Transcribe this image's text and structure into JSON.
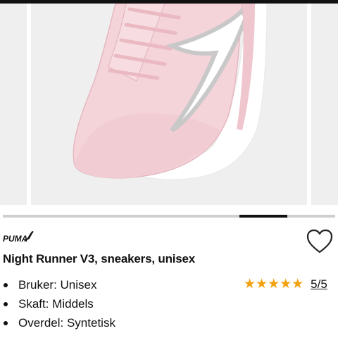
{
  "product": {
    "brand_logo_text": "PUMA",
    "title": "Night Runner V3, sneakers, unisex",
    "rating": {
      "stars": "★★★★★",
      "score_text": "5/5",
      "value": 5,
      "max": 5,
      "star_color": "#f2a20f"
    },
    "specs": [
      {
        "text": "Bruker: Unisex"
      },
      {
        "text": "Skaft: Middels"
      },
      {
        "text": "Overdel: Syntetisk"
      }
    ]
  },
  "gallery": {
    "active_index_fraction": 0.72,
    "shoe_color": "#f4d3d9",
    "stripe_color": "#c8c8c8",
    "sole_color": "#ffffff"
  },
  "icons": {
    "favorite": "heart-outline-icon",
    "brand": "puma-logo"
  }
}
